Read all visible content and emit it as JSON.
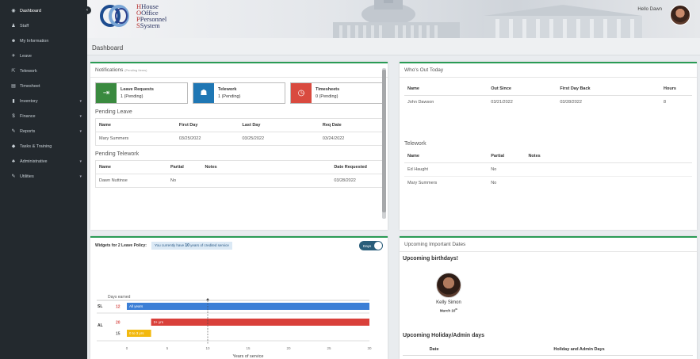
{
  "sidebar": {
    "items": [
      {
        "label": "Dashboard",
        "icon": "dashboard-icon",
        "glyph": "◉",
        "chevron": false,
        "active": true
      },
      {
        "label": "Staff",
        "icon": "person-icon",
        "glyph": "♟",
        "chevron": false
      },
      {
        "label": "My Information",
        "icon": "people-icon",
        "glyph": "☻",
        "chevron": false
      },
      {
        "label": "Leave",
        "icon": "plane-icon",
        "glyph": "✈",
        "chevron": false
      },
      {
        "label": "Telework",
        "icon": "external-link-icon",
        "glyph": "⇱",
        "chevron": false
      },
      {
        "label": "Timesheet",
        "icon": "document-icon",
        "glyph": "▤",
        "chevron": false
      },
      {
        "label": "Inventory",
        "icon": "bar-chart-icon",
        "glyph": "▮",
        "chevron": true
      },
      {
        "label": "Finance",
        "icon": "dollar-icon",
        "glyph": "$",
        "chevron": true
      },
      {
        "label": "Reports",
        "icon": "wrench-icon",
        "glyph": "✎",
        "chevron": true
      },
      {
        "label": "Tasks & Training",
        "icon": "graduation-cap-icon",
        "glyph": "◆",
        "chevron": false
      },
      {
        "label": "Administrative",
        "icon": "admin-users-icon",
        "glyph": "♣",
        "chevron": true
      },
      {
        "label": "Utilities",
        "icon": "tools-icon",
        "glyph": "✎",
        "chevron": true
      }
    ]
  },
  "header": {
    "logo_lines": [
      "House",
      "Office",
      "Personnel",
      "System"
    ],
    "greeting": "Hello Dawn",
    "page_title": "Dashboard"
  },
  "notifications": {
    "title": "Notifications",
    "subtitle": "(Pending Items)",
    "cards": [
      {
        "title": "Leave Requests",
        "value": "1 (Pending)",
        "color": "#3a8a3f",
        "icon": "exit-icon",
        "glyph": "⇥"
      },
      {
        "title": "Telework",
        "value": "1 (Pending)",
        "color": "#1f77b4",
        "icon": "person-laptop-icon",
        "glyph": "☗"
      },
      {
        "title": "Timesheets",
        "value": "0 (Pending)",
        "color": "#d94a3f",
        "icon": "clock-icon",
        "glyph": "◷"
      }
    ],
    "pending_leave": {
      "title": "Pending Leave",
      "headers": [
        "Name",
        "First Day",
        "Last Day",
        "Req Date"
      ],
      "rows": [
        [
          "Mary Summers",
          "03/25/2022",
          "03/25/2022",
          "03/24/2022"
        ]
      ]
    },
    "pending_telework": {
      "title": "Pending Telework",
      "headers": [
        "Name",
        "Partial",
        "Notes",
        "Date Requested"
      ],
      "rows": [
        [
          "Dawn Nuttinse",
          "No",
          "",
          "03/28/2022"
        ]
      ]
    }
  },
  "whos_out": {
    "title": "Who's Out Today",
    "headers": [
      "Name",
      "Out Since",
      "First Day Back",
      "Hours"
    ],
    "rows": [
      [
        "John Dawson",
        "03/21/2022",
        "03/28/2022",
        "8"
      ]
    ],
    "telework_title": "Telework",
    "telework_headers": [
      "Name",
      "Partial",
      "Notes"
    ],
    "telework_rows": [
      [
        "Ed Haught",
        "No",
        ""
      ],
      [
        "Mary Summers",
        "No",
        ""
      ]
    ]
  },
  "leave_widget": {
    "title": "Widgets for 2 Leave Policy:",
    "note_prefix": "You currently have ",
    "note_value": "10",
    "note_suffix": " years of credited service",
    "toggle_label": "Days"
  },
  "chart_data": {
    "type": "bar",
    "orientation": "horizontal",
    "title": "",
    "legend_label": "Days earned",
    "xlabel": "Years of service",
    "xlim": [
      0,
      30
    ],
    "xticks": [
      "0",
      "5",
      "10",
      "15",
      "20",
      "25",
      "30"
    ],
    "marker_x": 10,
    "groups": [
      {
        "label": "SL",
        "bars": [
          {
            "days": "12",
            "range_label": "All years",
            "start": 0,
            "end": 30,
            "color": "#3c7fd6",
            "days_color": "#d9534f"
          }
        ]
      },
      {
        "label": "AL",
        "bars": [
          {
            "days": "20",
            "range_label": "3+ yrs",
            "start": 3,
            "end": 30,
            "color": "#d9403a",
            "days_color": "#d9534f"
          },
          {
            "days": "15",
            "range_label": "0 to 3 yrs",
            "start": 0,
            "end": 3,
            "color": "#f2b90f",
            "days_color": "#666"
          }
        ]
      }
    ]
  },
  "upcoming": {
    "title": "Upcoming Important Dates",
    "birthdays_title": "Upcoming birthdays!",
    "person_name": "Kelly Simon",
    "person_date_prefix": "March 10",
    "person_date_suffix": "th",
    "holiday_title": "Upcoming Holiday/Admin days",
    "holiday_headers": [
      "Date",
      "Holiday and Admin Days"
    ]
  }
}
